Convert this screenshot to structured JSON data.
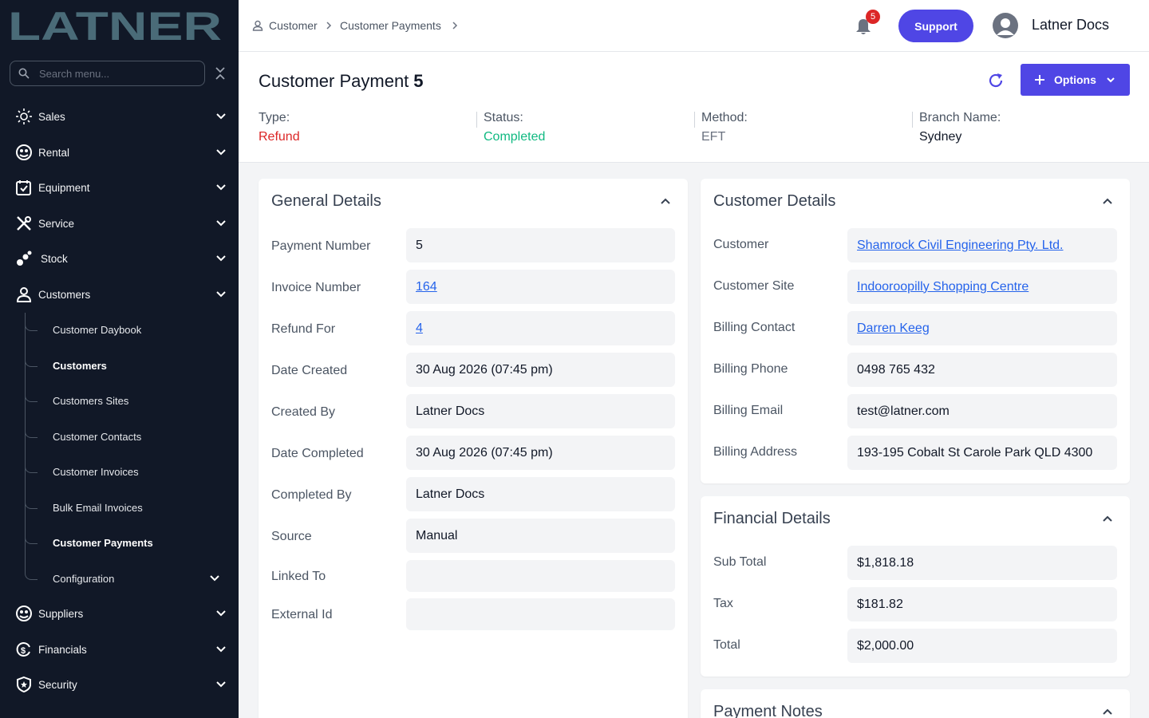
{
  "sidebar": {
    "logo_text": "LATNER",
    "search_placeholder": "Search menu...",
    "items": [
      {
        "label": "Sales",
        "icon": "sales-icon"
      },
      {
        "label": "Rental",
        "icon": "rental-icon"
      },
      {
        "label": "Equipment",
        "icon": "equipment-icon"
      },
      {
        "label": "Service",
        "icon": "service-icon"
      },
      {
        "label": "Stock",
        "icon": "stock-icon"
      },
      {
        "label": "Customers",
        "icon": "user-icon"
      }
    ],
    "sub_items": [
      {
        "label": "Customer Daybook"
      },
      {
        "label": "Customers"
      },
      {
        "label": "Customers Sites"
      },
      {
        "label": "Customer Contacts"
      },
      {
        "label": "Customer Invoices"
      },
      {
        "label": "Bulk Email Invoices"
      },
      {
        "label": "Customer Payments"
      },
      {
        "label": "Configuration"
      }
    ],
    "bottom_items": [
      {
        "label": "Suppliers",
        "icon": "suppliers-icon"
      },
      {
        "label": "Financials",
        "icon": "financials-icon"
      },
      {
        "label": "Security",
        "icon": "shield-icon"
      }
    ]
  },
  "topbar": {
    "breadcrumb": [
      "Customer",
      "Customer Payments"
    ],
    "notification_count": "5",
    "support_label": "Support",
    "user_name": "Latner Docs"
  },
  "header": {
    "title": "Customer Payment",
    "number": "5",
    "options_label": "Options",
    "type_label": "Type:",
    "type_value": "Refund",
    "status_label": "Status:",
    "status_value": "Completed",
    "method_label": "Method:",
    "method_value": "EFT",
    "branch_label": "Branch Name:",
    "branch_value": "Sydney",
    "type_color": "#dc2626",
    "status_color": "#10b981"
  },
  "general": {
    "title": "General Details",
    "rows": [
      {
        "label": "Payment Number",
        "value": "5"
      },
      {
        "label": "Invoice Number",
        "value": "164"
      },
      {
        "label": "Refund For",
        "value": "4"
      },
      {
        "label": "Date Created",
        "value": "30 Aug 2026 (07:45 pm)"
      },
      {
        "label": "Created By",
        "value": "Latner Docs"
      },
      {
        "label": "Date Completed",
        "value": "30 Aug 2026 (07:45 pm)"
      },
      {
        "label": "Completed By",
        "value": "Latner Docs"
      },
      {
        "label": "Source",
        "value": "Manual"
      },
      {
        "label": "Linked To",
        "value": ""
      },
      {
        "label": "External Id",
        "value": ""
      }
    ]
  },
  "customer": {
    "title": "Customer Details",
    "rows": [
      {
        "label": "Customer",
        "value": "Shamrock Civil Engineering Pty. Ltd."
      },
      {
        "label": "Customer Site",
        "value": "Indooroopilly Shopping Centre"
      },
      {
        "label": "Billing Contact",
        "value": "Darren Keeg"
      },
      {
        "label": "Billing Phone",
        "value": "0498 765 432"
      },
      {
        "label": "Billing Email",
        "value": "test@latner.com"
      },
      {
        "label": "Billing Address",
        "value": "193-195 Cobalt St Carole Park QLD 4300"
      }
    ]
  },
  "financial": {
    "title": "Financial Details",
    "rows": [
      {
        "label": "Sub Total",
        "value": "$1,818.18"
      },
      {
        "label": "Tax",
        "value": "$181.82"
      },
      {
        "label": "Total",
        "value": "$2,000.00"
      }
    ]
  },
  "notes": {
    "title": "Payment Notes"
  }
}
